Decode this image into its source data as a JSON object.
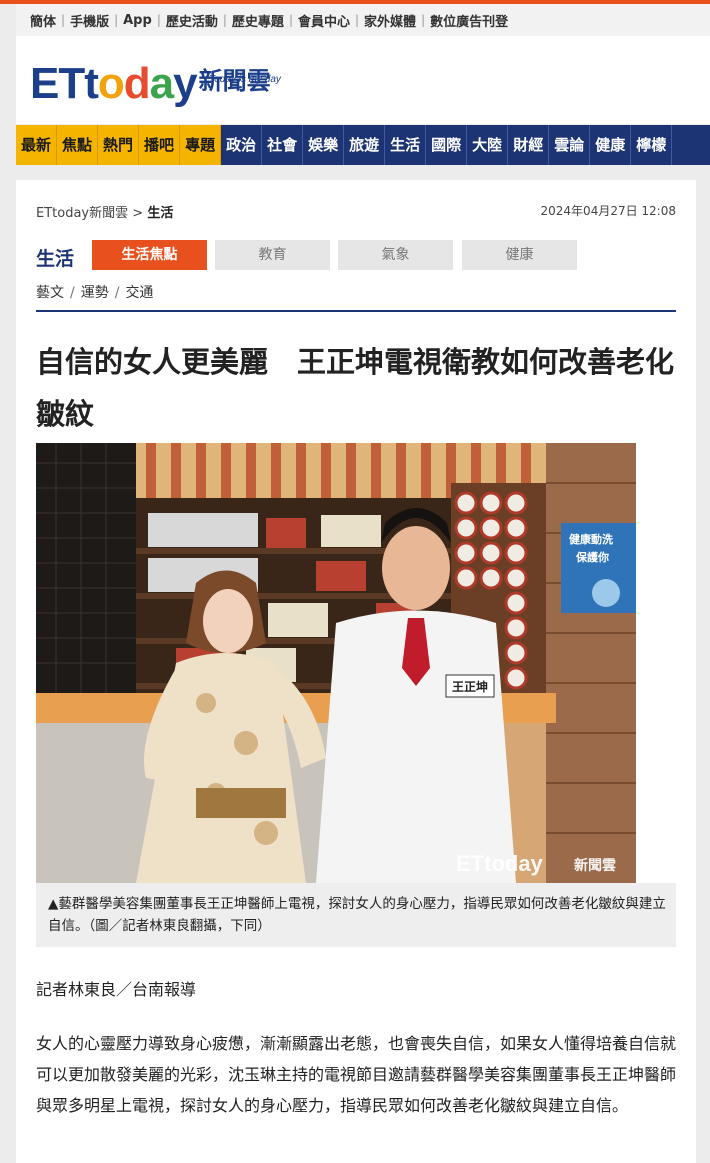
{
  "toplinks": [
    "簡体",
    "手機版",
    "App",
    "歷史活動",
    "歷史專題",
    "會員中心",
    "家外媒體",
    "數位廣告刊登"
  ],
  "logo": {
    "name": "ETtoday",
    "cn": "新聞雲",
    "sub": "Today is my day"
  },
  "nav": [
    "最新",
    "焦點",
    "熱門",
    "播吧",
    "專題",
    "政治",
    "社會",
    "娛樂",
    "旅遊",
    "生活",
    "國際",
    "大陸",
    "財經",
    "雲論",
    "健康",
    "檸檬"
  ],
  "breadcrumb": {
    "home": "ETtoday新聞雲",
    "sep": ">",
    "current": "生活"
  },
  "date": "2024年04月27日 12:08",
  "category": {
    "title": "生活",
    "tabs": [
      "生活焦點",
      "教育",
      "氣象",
      "健康"
    ],
    "subs": [
      "藝文",
      "運勢",
      "交通"
    ]
  },
  "headline": "自信的女人更美麗　王正坤電視衛教如何改善老化皺紋",
  "photo": {
    "name_tag": "王正坤",
    "poster_line1": "健康動洗",
    "poster_line2": "保護你",
    "watermark": "ETtoday",
    "watermark_cn": "新聞雲"
  },
  "caption": "▲藝群醫學美容集團董事長王正坤醫師上電視，探討女人的身心壓力，指導民眾如何改善老化皺紋與建立自信。（圖／記者林東良翻攝，下同）",
  "byline": "記者林東良／台南報導",
  "body": "女人的心靈壓力導致身心疲憊，漸漸顯露出老態，也會喪失自信，如果女人懂得培養自信就可以更加散發美麗的光彩，沈玉琳主持的電視節目邀請藝群醫學美容集團董事長王正坤醫師與眾多明星上電視，探討女人的身心壓力，指導民眾如何改善老化皺紋與建立自信。",
  "colors": {
    "accent": "#e8501e",
    "nav": "#1c3473",
    "highlight": "#f5b400"
  }
}
